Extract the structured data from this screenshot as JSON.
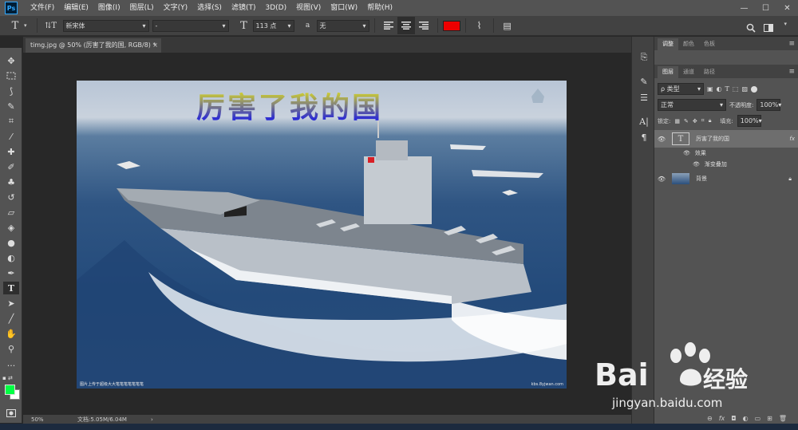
{
  "app": {
    "logo": "Ps"
  },
  "menu": [
    "文件(F)",
    "编辑(E)",
    "图像(I)",
    "图层(L)",
    "文字(Y)",
    "选择(S)",
    "滤镜(T)",
    "3D(D)",
    "视图(V)",
    "窗口(W)",
    "帮助(H)"
  ],
  "window_controls": {
    "minimize": "—",
    "maximize": "☐",
    "close": "✕"
  },
  "options": {
    "tool_glyph": "T",
    "orient_glyph": "⇅T",
    "font_family": "新宋体",
    "font_style": "-",
    "size_glyph": "T",
    "font_size": "113 点",
    "aa_label": "a",
    "aa_value": "无",
    "color": "#ee0000"
  },
  "document": {
    "tab_title": "timg.jpg @ 50% (厉害了我的国, RGB/8) *",
    "close": "×"
  },
  "image": {
    "text": "厉害了我的国",
    "bottom_caption": "图片上传于超级大大笔笔笔笔笔笔笔",
    "bottom_right": "kbs.8yjwan.com"
  },
  "status": {
    "zoom": "50%",
    "doc_info": "文档:5.05M/6.04M"
  },
  "panels": {
    "top_tabs": [
      "调整",
      "颜色",
      "色板"
    ],
    "layer_tabs": [
      "图层",
      "通道",
      "路径"
    ],
    "kind_filter": "ρ 类型",
    "blend_mode": "正常",
    "opacity_label": "不透明度:",
    "opacity_value": "100%",
    "lock_label": "锁定:",
    "fill_label": "填充:",
    "fill_value": "100%",
    "layers": [
      {
        "name": "厉害了我的国",
        "thumb": "T",
        "fx": "fx"
      },
      {
        "name": "效果"
      },
      {
        "name": "渐变叠加"
      },
      {
        "name": "背景"
      }
    ]
  },
  "watermark": {
    "brand": "Bai",
    "brand_cn": "经验",
    "url": "jingyan.baidu.com"
  }
}
